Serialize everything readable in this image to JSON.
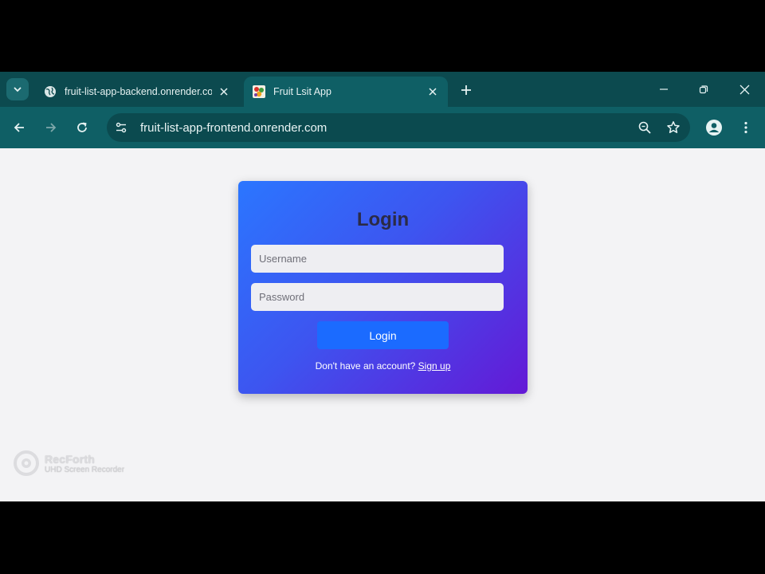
{
  "tabs": [
    {
      "title": "fruit-list-app-backend.onrender.com",
      "favicon": "globe-icon"
    },
    {
      "title": "Fruit Lsit App",
      "favicon": "fruit-favicon-icon"
    }
  ],
  "toolbar": {
    "url": "fruit-list-app-frontend.onrender.com"
  },
  "login": {
    "heading": "Login",
    "username_placeholder": "Username",
    "password_placeholder": "Password",
    "button_label": "Login",
    "signup_prompt": "Don't have an account?",
    "signup_link": "Sign up"
  },
  "watermark": {
    "title": "RecForth",
    "subtitle": "UHD Screen Recorder"
  },
  "colors": {
    "tabstrip": "#0c4a4f",
    "toolbar": "#0f5f65",
    "card_gradient_start": "#2b76ff",
    "card_gradient_end": "#6419d6",
    "button": "#1b6bff",
    "page_background": "#f3f3f5"
  }
}
